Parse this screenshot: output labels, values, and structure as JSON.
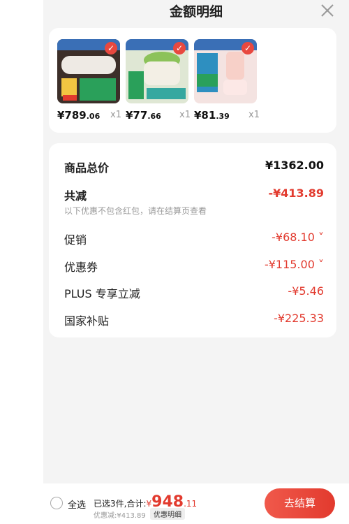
{
  "header": {
    "title": "金额明细",
    "close_icon": "close-icon"
  },
  "products": [
    {
      "name": "water-heater",
      "price_int": "¥789",
      "price_dec": ".06",
      "qty": "x1",
      "color_bg": "#d9d0c4"
    },
    {
      "name": "multi-cooker",
      "price_int": "¥77",
      "price_dec": ".66",
      "qty": "x1",
      "color_bg": "#e9e4d6"
    },
    {
      "name": "blender",
      "price_int": "¥81",
      "price_dec": ".39",
      "qty": "x1",
      "color_bg": "#f4e1df"
    }
  ],
  "details": {
    "total_label": "商品总价",
    "total_value": "¥1362.00",
    "discount_label": "共减",
    "discount_value": "-¥413.89",
    "note": "以下优惠不包含红包，请在结算页查看",
    "items": [
      {
        "label": "促销",
        "value": "-¥68.10",
        "has_chevron": true
      },
      {
        "label": "优惠券",
        "value": "-¥115.00",
        "has_chevron": true
      },
      {
        "label": "PLUS 专享立减",
        "value": "-¥5.46",
        "has_chevron": false
      },
      {
        "label": "国家补贴",
        "value": "-¥225.33",
        "has_chevron": false
      }
    ]
  },
  "bottom": {
    "select_all": "全选",
    "summary_prefix": "已选3件,合计:",
    "total_yen": "¥",
    "total_big": "948",
    "total_dec": ".11",
    "saved": "优惠减:¥413.89",
    "detail_tag": "优惠明细",
    "checkout": "去结算"
  },
  "colors": {
    "accent": "#e23a2e",
    "background": "#f4f4f4"
  }
}
